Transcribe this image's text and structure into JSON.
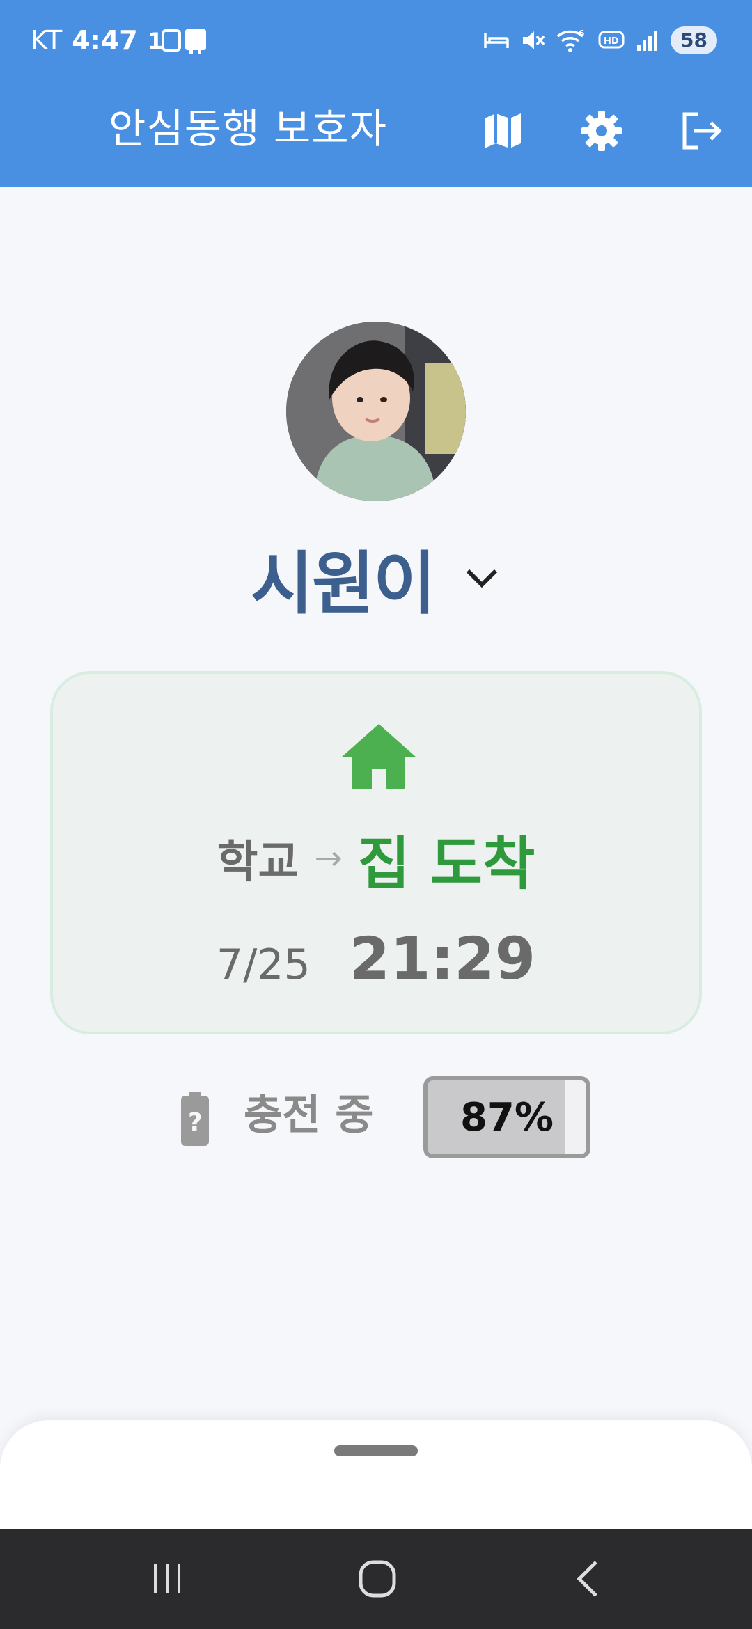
{
  "status_bar": {
    "carrier": "KT",
    "time": "4:47",
    "battery_level": "58",
    "icons": [
      "no-sim-icon",
      "sleep-mode-icon",
      "mute-icon",
      "wifi-6-icon",
      "hd-voice-icon",
      "signal-icon"
    ]
  },
  "app_bar": {
    "title": "안심동행 보호자",
    "icons": [
      "map-icon",
      "settings-gear-icon",
      "logout-icon"
    ]
  },
  "profile": {
    "child_name": "시원이",
    "avatar_alt": "child-photo"
  },
  "status_card": {
    "icon": "home-icon",
    "from": "학교",
    "arrow": "→",
    "to": "집 도착",
    "date": "7/25",
    "time": "21:29",
    "colors": {
      "accent": "#2e9a3c",
      "icon": "#4caf50",
      "card_bg": "#edf2f0"
    }
  },
  "battery": {
    "icon": "battery-unknown-icon",
    "status_label": "충전 중",
    "percent_label": "87%",
    "level": 0.87
  },
  "bottom_sheet": {
    "handle": "drag-handle"
  },
  "nav_bar": {
    "buttons": [
      "recent-apps-icon",
      "home-button-icon",
      "back-icon"
    ]
  },
  "colors": {
    "primary": "#4a90e2",
    "name_text": "#3c5f8e",
    "background": "#f5f7fb"
  }
}
